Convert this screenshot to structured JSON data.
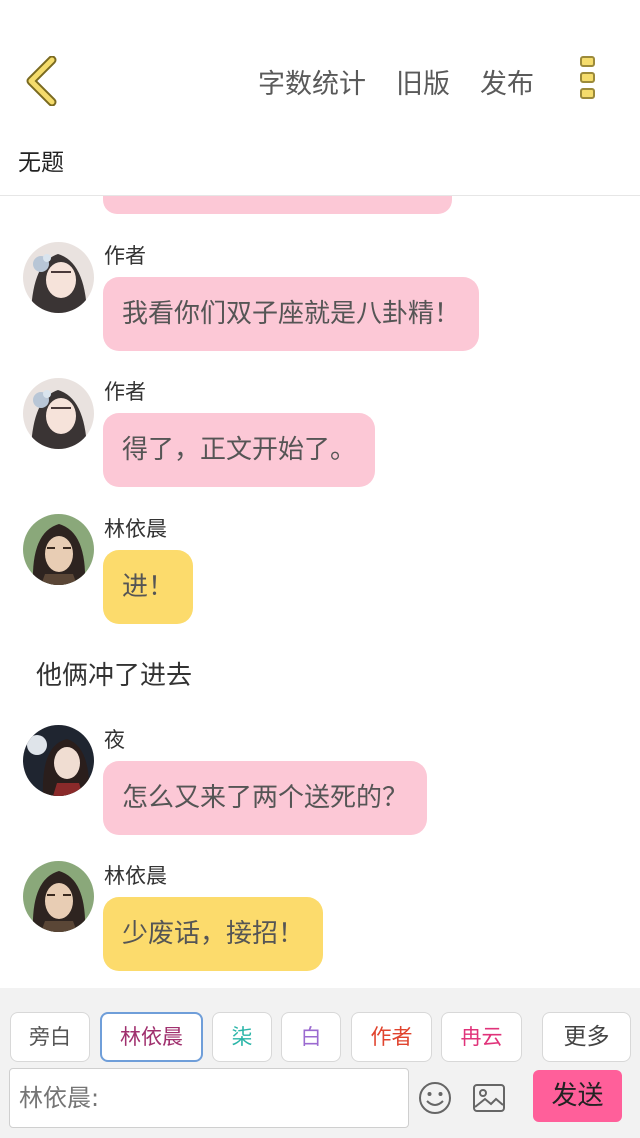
{
  "header": {
    "actions": [
      "字数统计",
      "旧版",
      "发布"
    ]
  },
  "document": {
    "title": "无题"
  },
  "messages": [
    {
      "speaker": "作者",
      "text": "我看你们双子座就是八卦精！"
    },
    {
      "speaker": "作者",
      "text": "得了，正文开始了。"
    },
    {
      "speaker": "林依晨",
      "text": "进！"
    },
    {
      "narration": "他俩冲了进去"
    },
    {
      "speaker": "夜",
      "text": "怎么又来了两个送死的？"
    },
    {
      "speaker": "林依晨",
      "text": "少废话，接招！"
    }
  ],
  "composer": {
    "roles": [
      {
        "label": "旁白",
        "color": "#555555"
      },
      {
        "label": "林依晨",
        "color": "#a0306e"
      },
      {
        "label": "柒",
        "color": "#2ab5a8"
      },
      {
        "label": "白",
        "color": "#9b6ad0"
      },
      {
        "label": "作者",
        "color": "#e0442e"
      },
      {
        "label": "冉云",
        "color": "#e0337a"
      }
    ],
    "more_label": "更多",
    "input_placeholder": "林依晨:",
    "send_label": "发送"
  },
  "colors": {
    "pink_bubble": "#fcc8d6",
    "yellow_bubble": "#fcdb6c",
    "send_button": "#ff5f9a",
    "selected_role_border": "#6f9ed9"
  },
  "icons": [
    "back-arrow-icon",
    "more-options-icon",
    "emoji-icon",
    "image-icon"
  ]
}
